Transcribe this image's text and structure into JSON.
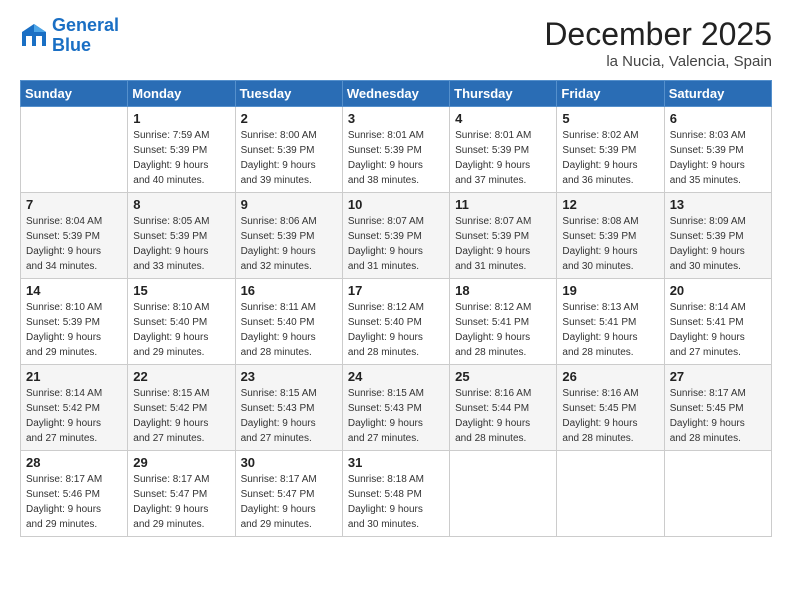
{
  "header": {
    "logo_line1": "General",
    "logo_line2": "Blue",
    "main_title": "December 2025",
    "subtitle": "la Nucia, Valencia, Spain"
  },
  "columns": [
    "Sunday",
    "Monday",
    "Tuesday",
    "Wednesday",
    "Thursday",
    "Friday",
    "Saturday"
  ],
  "weeks": [
    [
      {
        "day": "",
        "info": ""
      },
      {
        "day": "1",
        "info": "Sunrise: 7:59 AM\nSunset: 5:39 PM\nDaylight: 9 hours\nand 40 minutes."
      },
      {
        "day": "2",
        "info": "Sunrise: 8:00 AM\nSunset: 5:39 PM\nDaylight: 9 hours\nand 39 minutes."
      },
      {
        "day": "3",
        "info": "Sunrise: 8:01 AM\nSunset: 5:39 PM\nDaylight: 9 hours\nand 38 minutes."
      },
      {
        "day": "4",
        "info": "Sunrise: 8:01 AM\nSunset: 5:39 PM\nDaylight: 9 hours\nand 37 minutes."
      },
      {
        "day": "5",
        "info": "Sunrise: 8:02 AM\nSunset: 5:39 PM\nDaylight: 9 hours\nand 36 minutes."
      },
      {
        "day": "6",
        "info": "Sunrise: 8:03 AM\nSunset: 5:39 PM\nDaylight: 9 hours\nand 35 minutes."
      }
    ],
    [
      {
        "day": "7",
        "info": "Sunrise: 8:04 AM\nSunset: 5:39 PM\nDaylight: 9 hours\nand 34 minutes."
      },
      {
        "day": "8",
        "info": "Sunrise: 8:05 AM\nSunset: 5:39 PM\nDaylight: 9 hours\nand 33 minutes."
      },
      {
        "day": "9",
        "info": "Sunrise: 8:06 AM\nSunset: 5:39 PM\nDaylight: 9 hours\nand 32 minutes."
      },
      {
        "day": "10",
        "info": "Sunrise: 8:07 AM\nSunset: 5:39 PM\nDaylight: 9 hours\nand 31 minutes."
      },
      {
        "day": "11",
        "info": "Sunrise: 8:07 AM\nSunset: 5:39 PM\nDaylight: 9 hours\nand 31 minutes."
      },
      {
        "day": "12",
        "info": "Sunrise: 8:08 AM\nSunset: 5:39 PM\nDaylight: 9 hours\nand 30 minutes."
      },
      {
        "day": "13",
        "info": "Sunrise: 8:09 AM\nSunset: 5:39 PM\nDaylight: 9 hours\nand 30 minutes."
      }
    ],
    [
      {
        "day": "14",
        "info": "Sunrise: 8:10 AM\nSunset: 5:39 PM\nDaylight: 9 hours\nand 29 minutes."
      },
      {
        "day": "15",
        "info": "Sunrise: 8:10 AM\nSunset: 5:40 PM\nDaylight: 9 hours\nand 29 minutes."
      },
      {
        "day": "16",
        "info": "Sunrise: 8:11 AM\nSunset: 5:40 PM\nDaylight: 9 hours\nand 28 minutes."
      },
      {
        "day": "17",
        "info": "Sunrise: 8:12 AM\nSunset: 5:40 PM\nDaylight: 9 hours\nand 28 minutes."
      },
      {
        "day": "18",
        "info": "Sunrise: 8:12 AM\nSunset: 5:41 PM\nDaylight: 9 hours\nand 28 minutes."
      },
      {
        "day": "19",
        "info": "Sunrise: 8:13 AM\nSunset: 5:41 PM\nDaylight: 9 hours\nand 28 minutes."
      },
      {
        "day": "20",
        "info": "Sunrise: 8:14 AM\nSunset: 5:41 PM\nDaylight: 9 hours\nand 27 minutes."
      }
    ],
    [
      {
        "day": "21",
        "info": "Sunrise: 8:14 AM\nSunset: 5:42 PM\nDaylight: 9 hours\nand 27 minutes."
      },
      {
        "day": "22",
        "info": "Sunrise: 8:15 AM\nSunset: 5:42 PM\nDaylight: 9 hours\nand 27 minutes."
      },
      {
        "day": "23",
        "info": "Sunrise: 8:15 AM\nSunset: 5:43 PM\nDaylight: 9 hours\nand 27 minutes."
      },
      {
        "day": "24",
        "info": "Sunrise: 8:15 AM\nSunset: 5:43 PM\nDaylight: 9 hours\nand 27 minutes."
      },
      {
        "day": "25",
        "info": "Sunrise: 8:16 AM\nSunset: 5:44 PM\nDaylight: 9 hours\nand 28 minutes."
      },
      {
        "day": "26",
        "info": "Sunrise: 8:16 AM\nSunset: 5:45 PM\nDaylight: 9 hours\nand 28 minutes."
      },
      {
        "day": "27",
        "info": "Sunrise: 8:17 AM\nSunset: 5:45 PM\nDaylight: 9 hours\nand 28 minutes."
      }
    ],
    [
      {
        "day": "28",
        "info": "Sunrise: 8:17 AM\nSunset: 5:46 PM\nDaylight: 9 hours\nand 29 minutes."
      },
      {
        "day": "29",
        "info": "Sunrise: 8:17 AM\nSunset: 5:47 PM\nDaylight: 9 hours\nand 29 minutes."
      },
      {
        "day": "30",
        "info": "Sunrise: 8:17 AM\nSunset: 5:47 PM\nDaylight: 9 hours\nand 29 minutes."
      },
      {
        "day": "31",
        "info": "Sunrise: 8:18 AM\nSunset: 5:48 PM\nDaylight: 9 hours\nand 30 minutes."
      },
      {
        "day": "",
        "info": ""
      },
      {
        "day": "",
        "info": ""
      },
      {
        "day": "",
        "info": ""
      }
    ]
  ]
}
